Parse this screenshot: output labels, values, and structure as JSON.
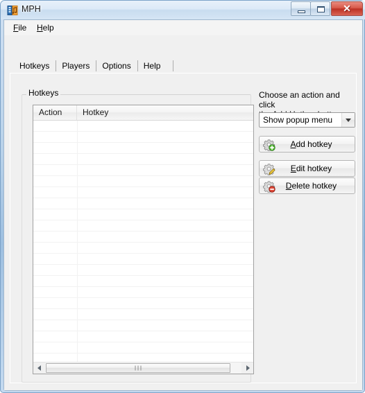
{
  "window": {
    "title": "MPH",
    "icon": "mph-app-icon",
    "controls": {
      "minimize": "minimize-button",
      "maximize": "maximize-button",
      "close": "close-button",
      "close_glyph": "✕"
    }
  },
  "menubar": {
    "items": [
      {
        "label": "File",
        "accel": "F"
      },
      {
        "label": "Help",
        "accel": "H"
      }
    ]
  },
  "tabs": [
    {
      "label": "Hotkeys",
      "selected": true
    },
    {
      "label": "Players",
      "selected": false
    },
    {
      "label": "Options",
      "selected": false
    },
    {
      "label": "Help",
      "selected": false
    }
  ],
  "groupbox": {
    "title": "Hotkeys"
  },
  "listview": {
    "columns": [
      "Action",
      "Hotkey"
    ],
    "rows": [],
    "row_count_visible": 22,
    "empty": true
  },
  "scrollbar": {
    "left_arrow": "scroll-left-arrow",
    "right_arrow": "scroll-right-arrow",
    "thumb": "horizontal-scroll-thumb"
  },
  "right_panel": {
    "hint_line1": "Choose an action and click",
    "hint_line2": "the Add Hotkey button:",
    "combo": {
      "value": "Show popup menu",
      "options": [
        "Show popup menu"
      ]
    },
    "buttons": [
      {
        "id": "add",
        "prefix": "",
        "accel": "A",
        "suffix": "dd hotkey",
        "icon": "gear-plus-icon"
      },
      {
        "id": "edit",
        "prefix": "",
        "accel": "E",
        "suffix": "dit hotkey",
        "icon": "gear-pencil-icon"
      },
      {
        "id": "delete",
        "prefix": "",
        "accel": "D",
        "suffix": "elete hotkey",
        "icon": "gear-minus-icon"
      }
    ]
  },
  "colors": {
    "frame": "#9dbfe0",
    "client": "#f0f0f0",
    "close_button": "#bc3124",
    "accent_green": "#4aa832",
    "accent_red": "#cc2b20",
    "accent_yellow": "#e8c030"
  }
}
